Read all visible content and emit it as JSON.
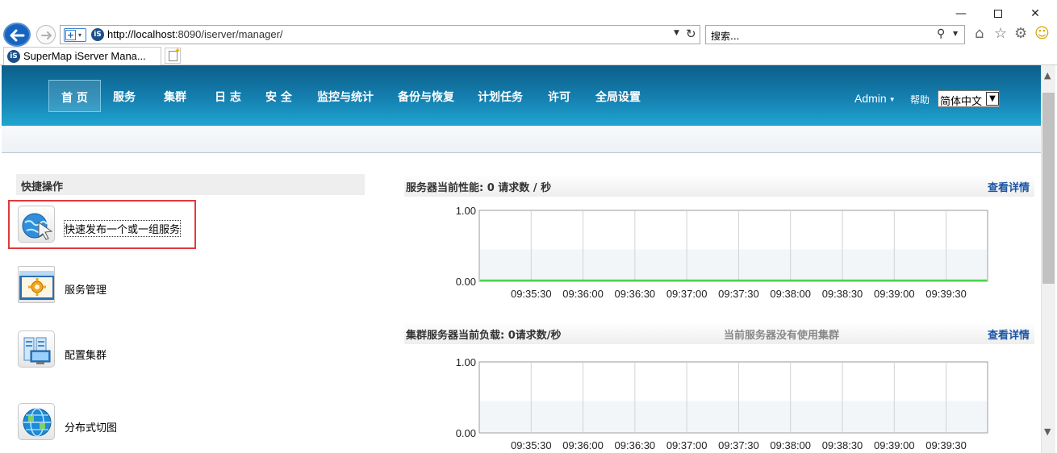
{
  "browser": {
    "url_host": "http://localhost",
    "url_rest": ":8090/iserver/manager/",
    "search_placeholder": "搜索...",
    "tab_title": "SuperMap iServer Mana...",
    "site_logo_text": "iS"
  },
  "header": {
    "nav": [
      {
        "label": "首 页"
      },
      {
        "label": "服务"
      },
      {
        "label": "集群"
      },
      {
        "label": "日 志"
      },
      {
        "label": "安 全"
      },
      {
        "label": "监控与统计"
      },
      {
        "label": "备份与恢复"
      },
      {
        "label": "计划任务"
      },
      {
        "label": "许可"
      },
      {
        "label": "全局设置"
      }
    ],
    "admin": "Admin",
    "help": "帮助",
    "language": "简体中文"
  },
  "quick_actions": {
    "title": "快捷操作",
    "items": [
      {
        "label": "快速发布一个或一组服务",
        "icon": "globe-publish-icon"
      },
      {
        "label": "服务管理",
        "icon": "service-gear-icon"
      },
      {
        "label": "配置集群",
        "icon": "cluster-servers-icon"
      },
      {
        "label": "分布式切图",
        "icon": "distributed-tiles-globe-icon"
      }
    ]
  },
  "panels": [
    {
      "title": "服务器当前性能:  0 请求数 / 秒",
      "link": "查看详情",
      "note": ""
    },
    {
      "title": "集群服务器当前负载: 0请求数/秒",
      "link": "查看详情",
      "note": "当前服务器没有使用集群"
    }
  ],
  "colors": {
    "header_top": "#0c5f8a",
    "header_bottom": "#1fa6d1",
    "link": "#1a55a5",
    "highlight_box": "#e03a3a",
    "series_line": "#4cd34c"
  },
  "chart_data": [
    {
      "type": "line",
      "title": "",
      "x": [
        "09:35:30",
        "09:36:00",
        "09:36:30",
        "09:37:00",
        "09:37:30",
        "09:38:00",
        "09:38:30",
        "09:39:00",
        "09:39:30"
      ],
      "series": [
        {
          "values": [
            0,
            0,
            0,
            0,
            0,
            0,
            0,
            0,
            0
          ]
        }
      ],
      "ylim": [
        0,
        1
      ],
      "yticks": [
        "1.00",
        "0.00"
      ],
      "grid": true
    },
    {
      "type": "line",
      "title": "",
      "x": [
        "09:35:30",
        "09:36:00",
        "09:36:30",
        "09:37:00",
        "09:37:30",
        "09:38:00",
        "09:38:30",
        "09:39:00",
        "09:39:30"
      ],
      "series": [],
      "ylim": [
        0,
        1
      ],
      "yticks": [
        "1.00",
        "0.00"
      ],
      "grid": true
    }
  ]
}
